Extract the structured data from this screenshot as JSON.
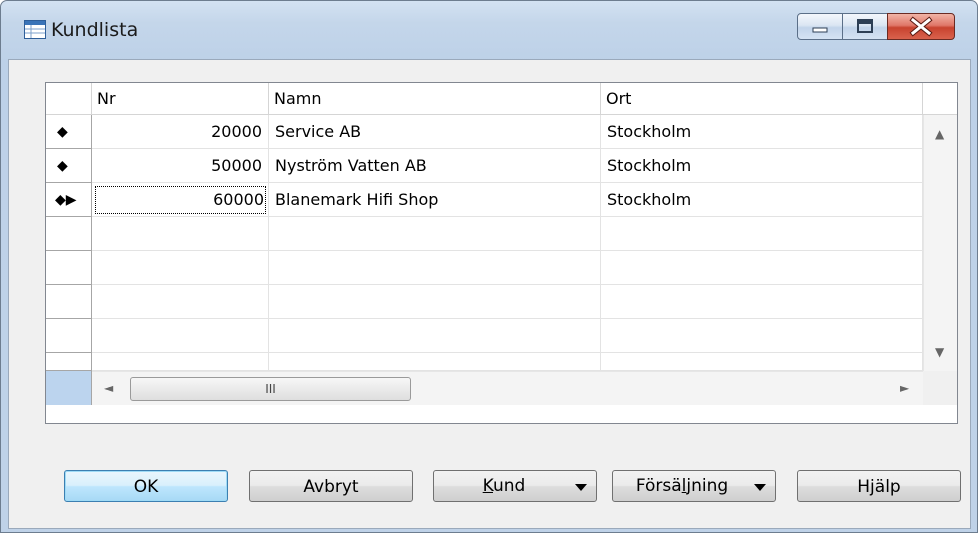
{
  "window": {
    "title": "Kundlista",
    "icons": {
      "app": "table-list-icon",
      "minimize": "minimize-icon",
      "maximize": "maximize-icon",
      "close": "close-icon"
    },
    "colors": {
      "title_bar": "#c4d6ea",
      "close_button": "#c8432f",
      "default_button_border": "#3c7fb1"
    }
  },
  "grid": {
    "columns": [
      {
        "label": "Nr"
      },
      {
        "label": "Namn"
      },
      {
        "label": "Ort"
      }
    ],
    "rows": [
      {
        "marker": "◆",
        "nr": "20000",
        "namn": "Service AB",
        "ort": "Stockholm"
      },
      {
        "marker": "◆",
        "nr": "50000",
        "namn": "Nyström Vatten AB",
        "ort": "Stockholm"
      },
      {
        "marker": "◆▶",
        "nr": "60000",
        "namn": "Blanemark Hifi Shop",
        "ort": "Stockholm"
      }
    ],
    "scroll": {
      "thumb_grip": "III",
      "left_arrow": "◄",
      "right_arrow": "►",
      "up_arrow": "▲",
      "down_arrow": "▼"
    }
  },
  "buttons": {
    "ok": "OK",
    "cancel": "Avbryt",
    "customer_pre": "",
    "customer_u": "K",
    "customer_post": "und",
    "sales_pre": "Försä",
    "sales_u": "l",
    "sales_post": "jning",
    "help": "Hjälp"
  }
}
